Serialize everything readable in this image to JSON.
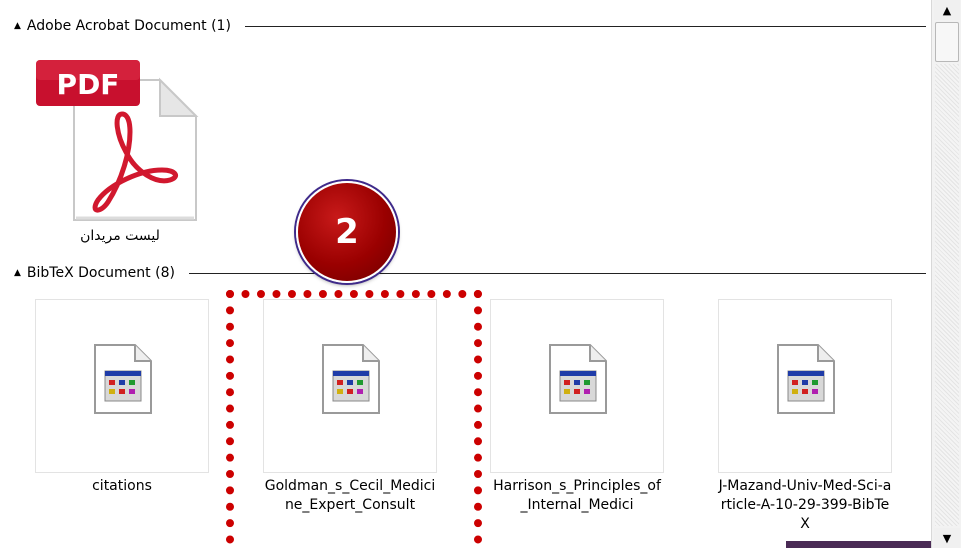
{
  "groups": [
    {
      "header": "Adobe Acrobat Document (1)"
    },
    {
      "header": "BibTeX Document (8)"
    }
  ],
  "pdf_item": {
    "badge_text": "PDF",
    "label": "لیست مریدان"
  },
  "bibtex_items": [
    {
      "label": "citations"
    },
    {
      "label": "Goldman_s_Cecil_Medicine_Expert_Consult"
    },
    {
      "label": "Harrison_s_Principles_of_Internal_Medici"
    },
    {
      "label": "J-Mazand-Univ-Med-Sci-article-A-10-29-399-BibTeX"
    }
  ],
  "annotation": {
    "number": "2"
  },
  "icons": {
    "collapse": "collapse-caret-icon",
    "pdf": "pdf-file-icon",
    "bibtex": "bibtex-file-icon",
    "scroll_up": "scroll-up-arrow-icon",
    "scroll_down": "scroll-down-arrow-icon"
  },
  "colors": {
    "annotation_red": "#cc0000",
    "badge_red": "#9a0000",
    "pdf_red": "#c8102e"
  }
}
